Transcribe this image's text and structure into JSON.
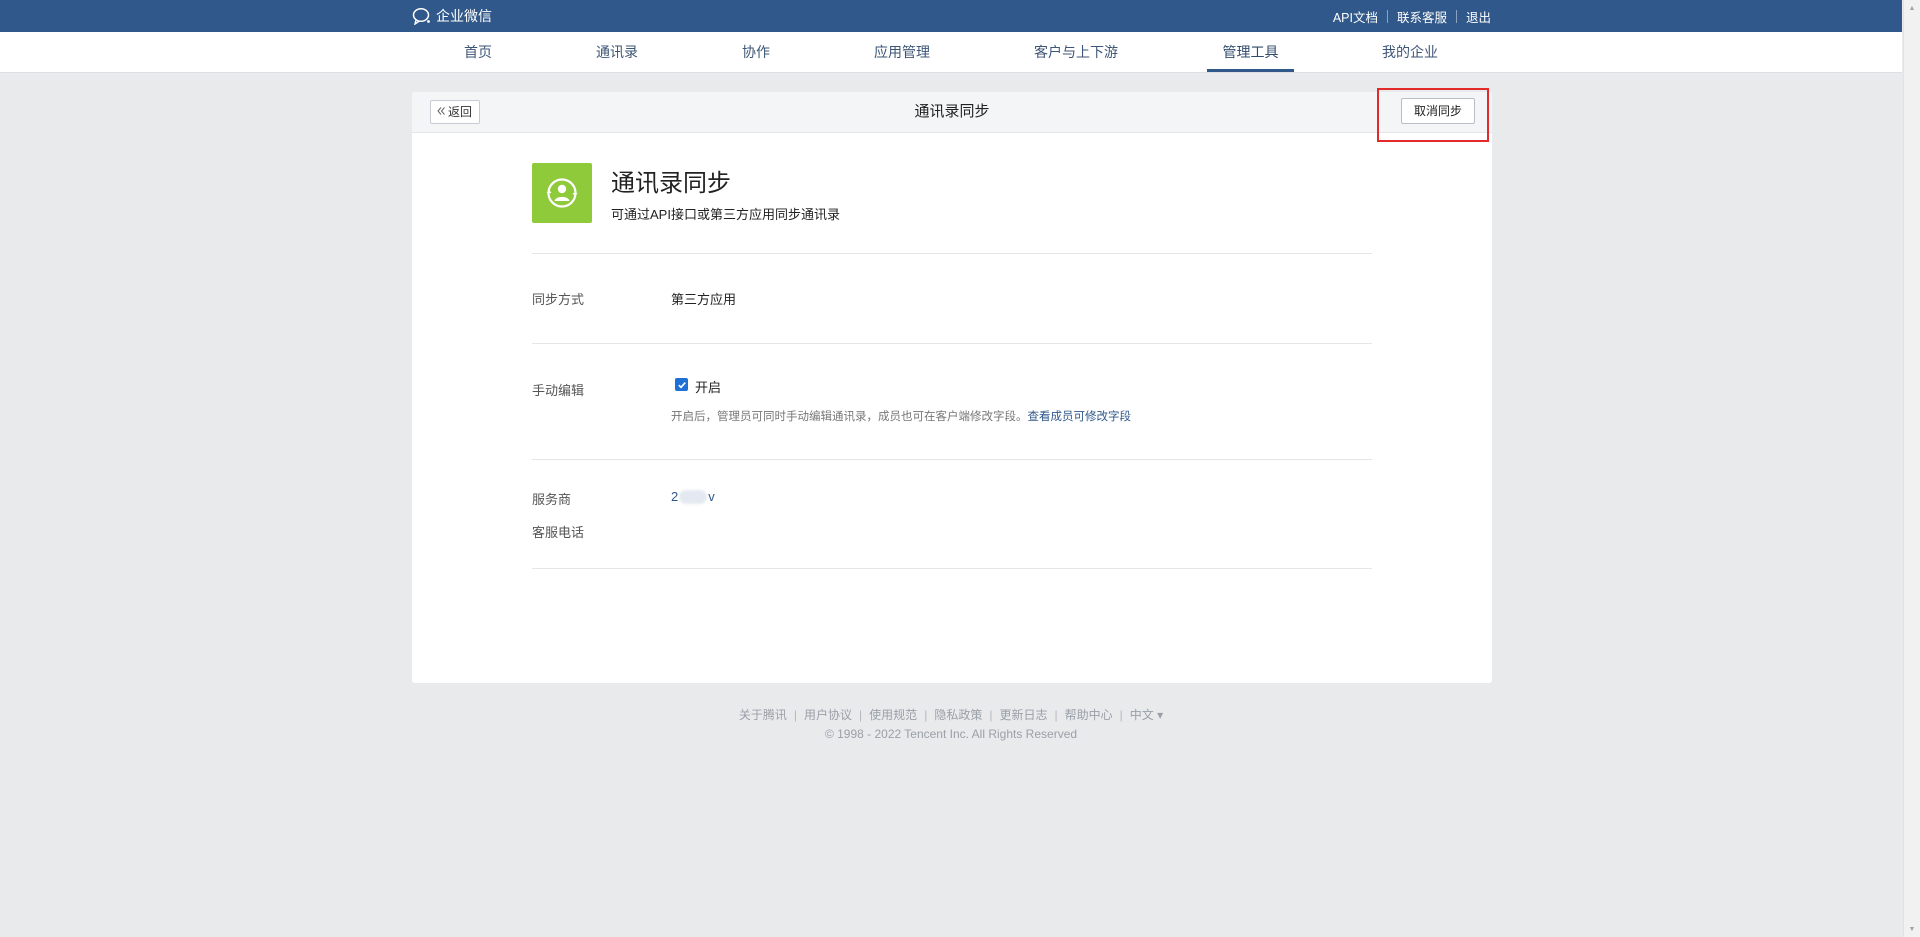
{
  "brand": {
    "name": "企业微信"
  },
  "toplinks": [
    "API文档",
    "联系客服",
    "退出"
  ],
  "nav": [
    "首页",
    "通讯录",
    "协作",
    "应用管理",
    "客户与上下游",
    "管理工具",
    "我的企业"
  ],
  "card": {
    "back_label": "返回",
    "title": "通讯录同步",
    "cancel_label": "取消同步"
  },
  "app": {
    "name": "通讯录同步",
    "desc": "可通过API接口或第三方应用同步通讯录"
  },
  "sync_method": {
    "label": "同步方式",
    "value": "第三方应用"
  },
  "manual_edit": {
    "label": "手动编辑",
    "checked": true,
    "check_label": "开启",
    "hint": "开启后，管理员可同时手动编辑通讯录，成员也可在客户端修改字段。",
    "hint_link": "查看成员可修改字段"
  },
  "provider": {
    "label": "服务商",
    "value_start": "2",
    "value_end": "v"
  },
  "support_phone": {
    "label": "客服电话"
  },
  "footer": {
    "links": [
      "关于腾讯",
      "用户协议",
      "使用规范",
      "隐私政策",
      "更新日志",
      "帮助中心",
      "中文 ▾"
    ],
    "copyright": "© 1998 - 2022 Tencent Inc. All Rights Reserved"
  },
  "colors": {
    "topbar": "#31588a",
    "accent": "#31588a",
    "app_icon": "#8fca3a",
    "highlight": "#e32a2a"
  }
}
